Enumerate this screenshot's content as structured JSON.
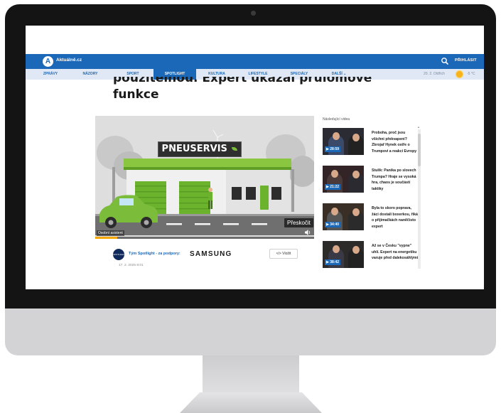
{
  "site": {
    "logo_letter": "A",
    "logo_text": "Aktuálně.cz",
    "login_label": "PŘIHLÁSIT"
  },
  "nav": {
    "items": [
      {
        "label": "ZPRÁVY",
        "active": false
      },
      {
        "label": "NÁZORY",
        "active": false
      },
      {
        "label": "SPORT",
        "active": false
      },
      {
        "label": "SPOTLIGHT",
        "active": true
      },
      {
        "label": "KULTURA",
        "active": false
      },
      {
        "label": "LIFESTYLE",
        "active": false
      },
      {
        "label": "SPECIÁLY",
        "active": false
      },
      {
        "label": "DALŠÍ ⌄",
        "active": false
      }
    ],
    "date": "20. 2. Oldřich",
    "temperature": "-5 °C"
  },
  "article": {
    "title_line1": "použitelnou. Expert ukázal průlomové",
    "title_line2": "funkce",
    "byline_name": "Tým Spotlight - za podpory:",
    "byline_brand": "SAMSUNG",
    "embed_label": "</> Vložit",
    "date": "17. 2. 2025 8:01"
  },
  "video": {
    "sign_text": "PNEUSERVIS",
    "subtitle": "Osobní asistent",
    "skip_label": "Přeskočit",
    "progress": 0.1
  },
  "sidebar": {
    "title": "Následující videa",
    "items": [
      {
        "duration": "▶ 28:59",
        "text": "Proboha, proč jsou všichni překvapeni? Zbrojař Hynek ostře o Trumpovi a reakci Evropy"
      },
      {
        "duration": "▶ 21:22",
        "text": "Stulík: Panika po slovech Trumpa? Hraje se vysoká hra, chaos je součástí taktiky"
      },
      {
        "duration": "▶ 34:40",
        "text": "Byla to skoro poprava, žáci dostali boxerkou, říká o přijímačkách naněčisto expert"
      },
      {
        "duration": "▶ 38:42",
        "text": "Až se v Česku \"vypne\" uhlí. Expert na energetiku varuje před dalekosáhlými"
      }
    ]
  },
  "colors": {
    "brand": "#1b67b8",
    "accent": "#f5a800"
  }
}
